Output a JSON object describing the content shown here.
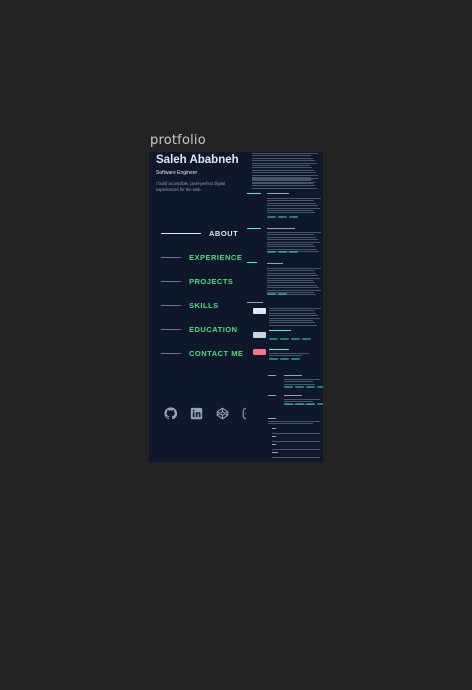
{
  "card": {
    "title": "protfolio"
  },
  "profile": {
    "name": "Saleh Ababneh",
    "role": "Software Engineer",
    "tagline": "I build accessible, pixel-perfect digital experiences for the web."
  },
  "nav": {
    "items": [
      {
        "label": "ABOUT",
        "active": true
      },
      {
        "label": "EXPERIENCE",
        "active": false
      },
      {
        "label": "PROJECTS",
        "active": false
      },
      {
        "label": "SKILLS",
        "active": false
      },
      {
        "label": "EDUCATION",
        "active": false
      },
      {
        "label": "CONTACT ME",
        "active": false
      }
    ]
  },
  "socials": [
    "github-icon",
    "linkedin-icon",
    "codepen-icon",
    "instagram-icon"
  ],
  "colors": {
    "page_bg": "#232323",
    "preview_bg": "#0f172a",
    "accent": "#5eead4",
    "nav_green": "#4ade80",
    "text_light": "#e2e8f0",
    "text_muted": "#94a3b8"
  }
}
